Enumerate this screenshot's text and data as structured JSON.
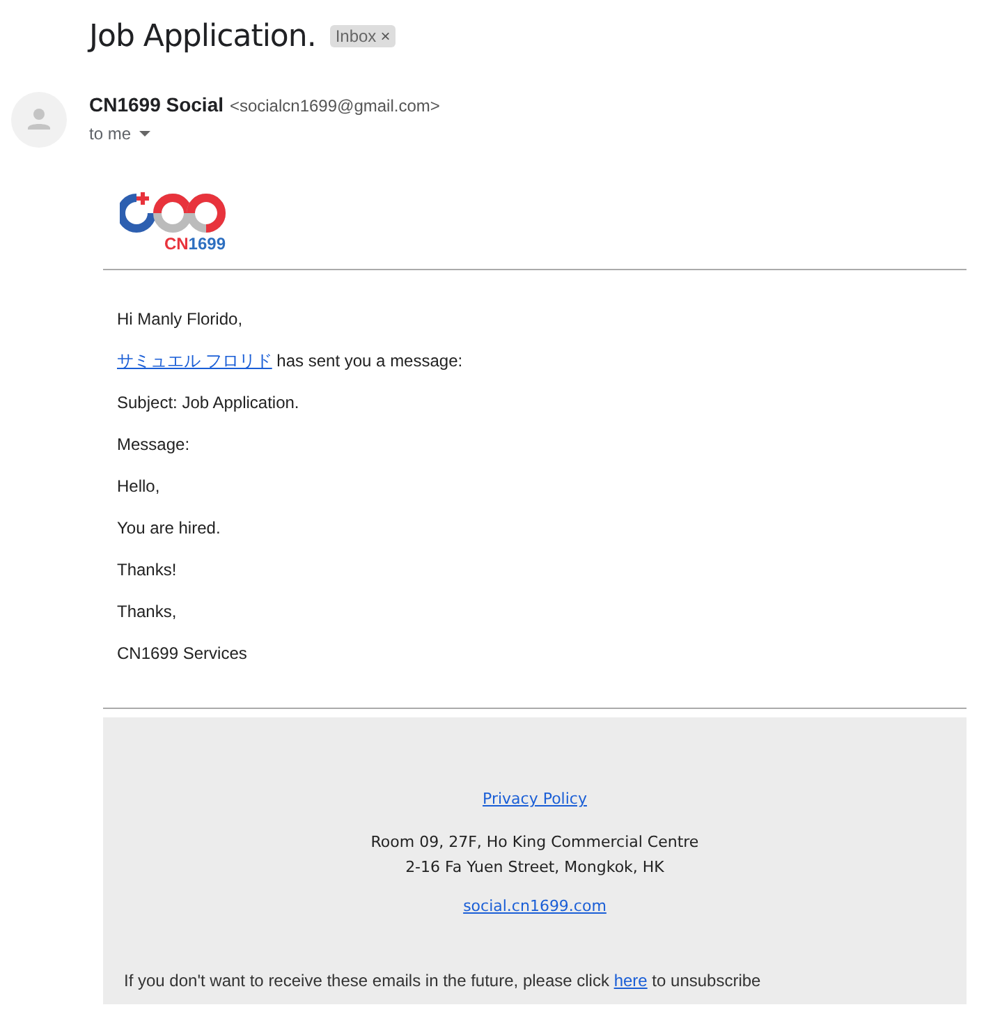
{
  "subject": "Job Application.",
  "label": {
    "text": "Inbox",
    "close": "×"
  },
  "sender": {
    "name": "CN1699 Social",
    "email": "<socialcn1699@gmail.com>",
    "recipient": "to me"
  },
  "logo": {
    "parts": [
      {
        "text": "CN",
        "color": "#e8333c"
      },
      {
        "text": "1699",
        "color": "#2d6fc0"
      }
    ]
  },
  "greeting": "Hi Manly Florido,",
  "notice": {
    "link": "サミュエル フロリド",
    "text": " has sent you a message:"
  },
  "lines": [
    "Subject: Job Application.",
    "Message:",
    "Hello,",
    "You are hired.",
    "Thanks!",
    "Thanks,",
    "CN1699 Services"
  ],
  "footer": {
    "privacy": "Privacy Policy",
    "address": [
      "Room 09, 27F, Ho King Commercial Centre",
      "2-16 Fa Yuen Street, Mongkok, HK"
    ],
    "site": "social.cn1699.com",
    "unsubscribe": {
      "before": "If you don't want to receive these emails in the future, please click ",
      "link": "here",
      "after": " to unsubscribe"
    }
  }
}
